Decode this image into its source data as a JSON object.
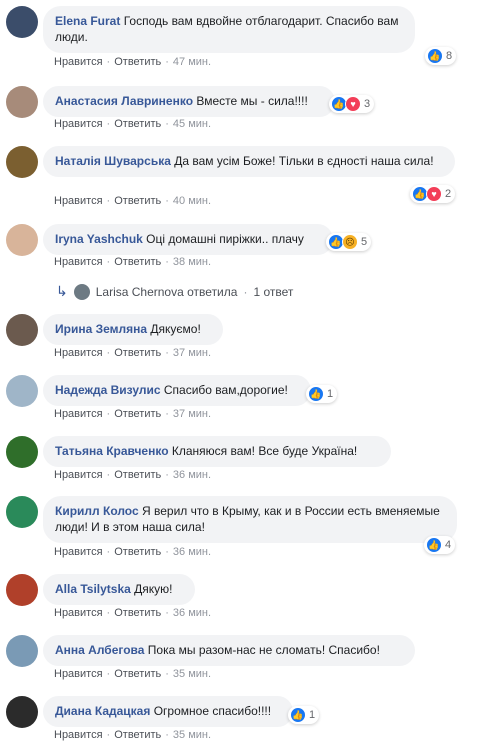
{
  "labels": {
    "like": "Нравится",
    "reply": "Ответить",
    "dot": "·"
  },
  "comments": [
    {
      "author": "Elena Furat",
      "text": "Господь вам вдвойне отблагодарит. Спасибо вам люди.",
      "time": "47 мин.",
      "reactions": "8",
      "avatar_color": "#3b4d6a",
      "icons": [
        "like-icon"
      ]
    },
    {
      "author": "Анастасия Лавриненко",
      "text": "Вместе мы - сила!!!!",
      "time": "45 мин.",
      "reactions": "3",
      "avatar_color": "#a78b7a",
      "icons": [
        "like-icon",
        "love-icon"
      ]
    },
    {
      "author": "Наталія Шуварська",
      "text": "Да вам усім Боже! Тільки в єдності наша сила!",
      "time": "40 мин.",
      "reactions": "2",
      "avatar_color": "#7b5f30",
      "icons": [
        "like-icon",
        "love-icon"
      ]
    },
    {
      "author": "Iryna Yashchuk",
      "text": "Оці домашні пиріжки.. плачу",
      "time": "38 мин.",
      "reactions": "5",
      "avatar_color": "#d8b49a",
      "icons": [
        "like-icon",
        "sad-icon"
      ]
    },
    {
      "author": "Ирина Земляна",
      "text": "Дякуємо!",
      "time": "37 мин.",
      "reactions": "",
      "avatar_color": "#6b5a4e",
      "icons": []
    },
    {
      "author": "Надежда Визулис",
      "text": "Спасибо вам,дорогие!",
      "time": "37 мин.",
      "reactions": "1",
      "avatar_color": "#9fb5c8",
      "icons": [
        "like-icon"
      ]
    },
    {
      "author": "Татьяна Кравченко",
      "text": "Кланяюся вам! Все буде Україна!",
      "time": "36 мин.",
      "reactions": "",
      "avatar_color": "#2f6e2a",
      "icons": []
    },
    {
      "author": "Кирилл Колос",
      "text": "Я верил что в Крыму, как и в России есть вменяемые люди! И в этом наша сила!",
      "time": "36 мин.",
      "reactions": "4",
      "avatar_color": "#2a8a5a",
      "icons": [
        "like-icon"
      ]
    },
    {
      "author": "Alla Tsilytska",
      "text": "Дякую!",
      "time": "36 мин.",
      "reactions": "",
      "avatar_color": "#b0402a",
      "icons": []
    },
    {
      "author": "Анна Албегова",
      "text": "Пока мы разом-нас не сломать! Спасибо!",
      "time": "35 мин.",
      "reactions": "",
      "avatar_color": "#7a9ab5",
      "icons": []
    },
    {
      "author": "Диана Кадацкая",
      "text": "Огромное спасибо!!!!",
      "time": "35 мин.",
      "reactions": "1",
      "avatar_color": "#2b2b2b",
      "icons": [
        "like-icon"
      ]
    }
  ],
  "reply_preview": {
    "arrow": "↳",
    "author": "Larisa Chernova",
    "verb": "ответила",
    "count": "1 ответ"
  }
}
